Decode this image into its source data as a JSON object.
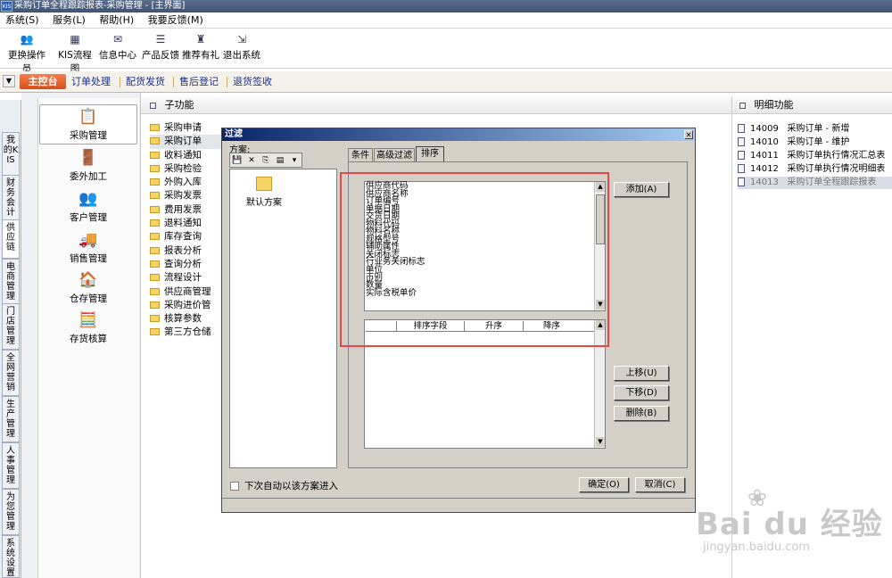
{
  "window": {
    "title": "采购订单全程跟踪报表-采购管理 - [主界面]",
    "logo": "KIS"
  },
  "menu": [
    "系统(S)",
    "服务(L)",
    "帮助(H)",
    "我要反馈(M)"
  ],
  "toolbar": [
    {
      "label": "更换操作员",
      "icon": "user-switch-icon"
    },
    {
      "label": "KIS流程图",
      "icon": "flowchart-icon"
    },
    {
      "label": "信息中心",
      "icon": "message-icon"
    },
    {
      "label": "产品反馈",
      "icon": "feedback-icon"
    },
    {
      "label": "推荐有礼",
      "icon": "gift-icon"
    },
    {
      "label": "退出系统",
      "icon": "exit-icon"
    }
  ],
  "nav": {
    "home": "主控台",
    "items": [
      "订单处理",
      "配货发货",
      "售后登记",
      "退货签收"
    ]
  },
  "side_tabs": [
    "我的KIS",
    "财务会计",
    "供应链",
    "电商管理",
    "门店管理",
    "全网营销",
    "生产管理",
    "人事管理",
    "为您管理",
    "系统设置"
  ],
  "modules": [
    "采购管理",
    "委外加工",
    "客户管理",
    "销售管理",
    "仓存管理",
    "存货核算"
  ],
  "subfunc": {
    "title": "子功能",
    "items": [
      "采购申请",
      "采购订单",
      "收料通知",
      "采购检验",
      "外购入库",
      "采购发票",
      "费用发票",
      "退料通知",
      "库存查询",
      "报表分析",
      "查询分析",
      "流程设计",
      "供应商管理",
      "采购进价管",
      "核算参数",
      "第三方仓储"
    ]
  },
  "detail": {
    "title": "明细功能",
    "items": [
      {
        "code": "14009",
        "name": "采购订单 - 新增"
      },
      {
        "code": "14010",
        "name": "采购订单 - 维护"
      },
      {
        "code": "14011",
        "name": "采购订单执行情况汇总表"
      },
      {
        "code": "14012",
        "name": "采购订单执行情况明细表"
      },
      {
        "code": "14013",
        "name": "采购订单全程跟踪报表"
      }
    ]
  },
  "dialog": {
    "title": "过滤",
    "scheme_label": "方案:",
    "default_scheme": "默认方案",
    "auto_enter": "下次自动以该方案进入",
    "tabs": [
      "条件",
      "高级过滤",
      "排序"
    ],
    "fields": [
      "供应商代码",
      "供应商名称",
      "订单编号",
      "单据日期",
      "交货日期",
      "物料代码",
      "物料名称",
      "规格型号",
      "辅助属性",
      "关闭标志",
      "行业务关闭标志",
      "单位",
      "币别",
      "数量",
      "实际含税单价"
    ],
    "sort_columns": [
      "排序字段",
      "升序",
      "降序"
    ],
    "buttons": {
      "add": "添加(A)",
      "up": "上移(U)",
      "down": "下移(D)",
      "delete": "删除(B)",
      "ok": "确定(O)",
      "cancel": "取消(C)"
    }
  },
  "watermark": {
    "main": "Bai du 经验",
    "sub": "jingyan.baidu.com"
  },
  "colors": {
    "highlight_box": "#e84848",
    "dialog_title": "#0a246a",
    "home_button": "#e05a26"
  }
}
